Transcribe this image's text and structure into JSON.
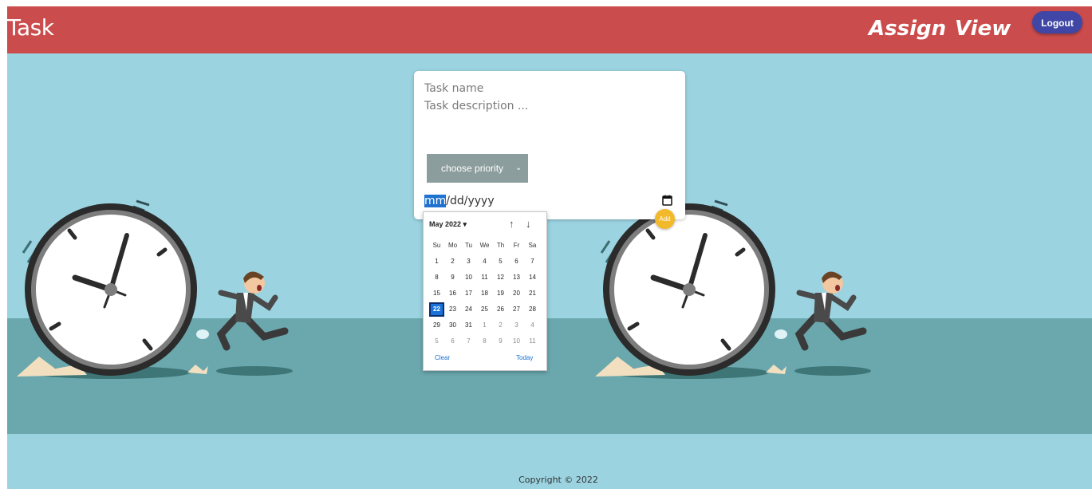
{
  "header": {
    "brand": "Task",
    "nav": [
      "Assign",
      "View"
    ],
    "logout_label": "Logout"
  },
  "form": {
    "task_name_placeholder": "Task name",
    "task_description_placeholder": "Task description ...",
    "priority_label": "choose priority",
    "date": {
      "month_segment": "mm",
      "rest": "/dd/yyyy"
    },
    "add_label": "Add"
  },
  "calendar": {
    "month_label": "May 2022",
    "weekdays": [
      "Su",
      "Mo",
      "Tu",
      "We",
      "Th",
      "Fr",
      "Sa"
    ],
    "weeks": [
      [
        "1",
        "2",
        "3",
        "4",
        "5",
        "6",
        "7"
      ],
      [
        "8",
        "9",
        "10",
        "11",
        "12",
        "13",
        "14"
      ],
      [
        "15",
        "16",
        "17",
        "18",
        "19",
        "20",
        "21"
      ],
      [
        "22",
        "23",
        "24",
        "25",
        "26",
        "27",
        "28"
      ],
      [
        "29",
        "30",
        "31",
        "1",
        "2",
        "3",
        "4"
      ],
      [
        "5",
        "6",
        "7",
        "8",
        "9",
        "10",
        "11"
      ]
    ],
    "selected_day": "22",
    "clear_label": "Clear",
    "today_label": "Today"
  },
  "footer": {
    "copyright": "Copyright © 2022"
  },
  "colors": {
    "header": "#cb4c4c",
    "background": "#9bd3e1",
    "ground": "#6aa8ae",
    "logout": "#3f46a5",
    "add": "#f2b92a",
    "priority": "#8b9d9c",
    "selected_day": "#1a73d9"
  }
}
